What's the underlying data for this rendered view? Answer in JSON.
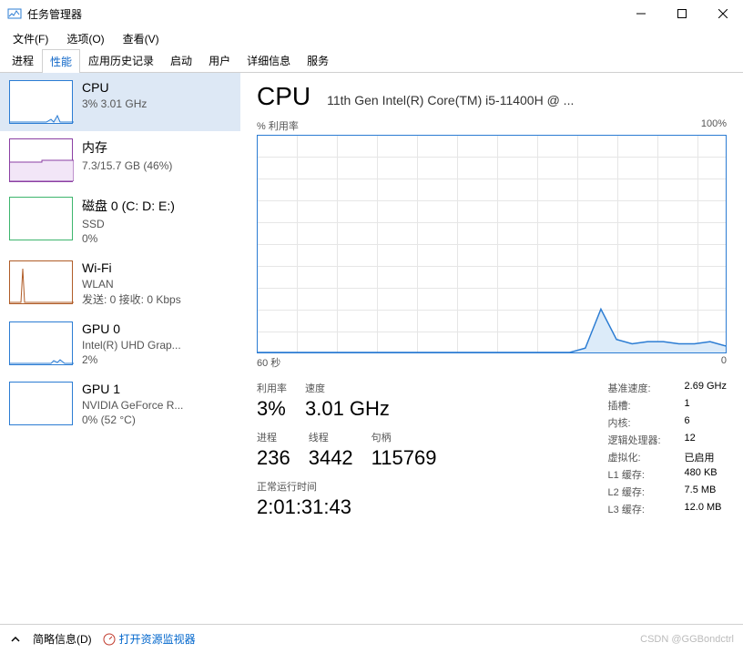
{
  "window": {
    "title": "任务管理器"
  },
  "menus": {
    "file": "文件(F)",
    "options": "选项(O)",
    "view": "查看(V)"
  },
  "tabs": {
    "processes": "进程",
    "performance": "性能",
    "apphistory": "应用历史记录",
    "startup": "启动",
    "users": "用户",
    "details": "详细信息",
    "services": "服务"
  },
  "sidebar": {
    "cpu": {
      "title": "CPU",
      "sub": "3% 3.01 GHz"
    },
    "mem": {
      "title": "内存",
      "sub": "7.3/15.7 GB (46%)"
    },
    "disk": {
      "title": "磁盘 0 (C: D: E:)",
      "sub1": "SSD",
      "sub2": "0%"
    },
    "wifi": {
      "title": "Wi-Fi",
      "sub1": "WLAN",
      "sub2": "发送: 0 接收: 0 Kbps"
    },
    "gpu0": {
      "title": "GPU 0",
      "sub1": "Intel(R) UHD Grap...",
      "sub2": "2%"
    },
    "gpu1": {
      "title": "GPU 1",
      "sub1": "NVIDIA GeForce R...",
      "sub2": "0% (52 °C)"
    }
  },
  "main": {
    "heading": "CPU",
    "model": "11th Gen Intel(R) Core(TM) i5-11400H @ ...",
    "chart_top_left": "% 利用率",
    "chart_top_right": "100%",
    "chart_bot_left": "60 秒",
    "chart_bot_right": "0",
    "stats": {
      "util_label": "利用率",
      "util": "3%",
      "speed_label": "速度",
      "speed": "3.01 GHz",
      "proc_label": "进程",
      "proc": "236",
      "thread_label": "线程",
      "thread": "3442",
      "handle_label": "句柄",
      "handle": "115769",
      "uptime_label": "正常运行时间",
      "uptime": "2:01:31:43"
    },
    "details": {
      "base_k": "基准速度:",
      "base_v": "2.69 GHz",
      "sock_k": "插槽:",
      "sock_v": "1",
      "core_k": "内核:",
      "core_v": "6",
      "logi_k": "逻辑处理器:",
      "logi_v": "12",
      "virt_k": "虚拟化:",
      "virt_v": "已启用",
      "l1_k": "L1 缓存:",
      "l1_v": "480 KB",
      "l2_k": "L2 缓存:",
      "l2_v": "7.5 MB",
      "l3_k": "L3 缓存:",
      "l3_v": "12.0 MB"
    }
  },
  "footer": {
    "brief": "简略信息(D)",
    "resmon": "打开资源监视器",
    "watermark": "CSDN @GGBondctrl"
  },
  "colors": {
    "cpu": "#2b7cd3",
    "mem": "#8b3fa3",
    "disk": "#3db56d",
    "wifi": "#b05c27",
    "gpu": "#2b7cd3"
  },
  "chart_data": {
    "type": "line",
    "title": "% 利用率",
    "ylabel": "% 利用率",
    "xlabel": "秒",
    "xlim": [
      60,
      0
    ],
    "ylim": [
      0,
      100
    ],
    "x_seconds_ago": [
      60,
      58,
      56,
      54,
      52,
      50,
      48,
      46,
      44,
      42,
      40,
      38,
      36,
      34,
      32,
      30,
      28,
      26,
      24,
      22,
      20,
      18,
      16,
      14,
      12,
      10,
      8,
      6,
      4,
      2,
      0
    ],
    "utilization_pct": [
      0,
      0,
      0,
      0,
      0,
      0,
      0,
      0,
      0,
      0,
      0,
      0,
      0,
      0,
      0,
      0,
      0,
      0,
      0,
      0,
      0,
      2,
      20,
      6,
      4,
      5,
      5,
      4,
      4,
      5,
      3
    ]
  }
}
